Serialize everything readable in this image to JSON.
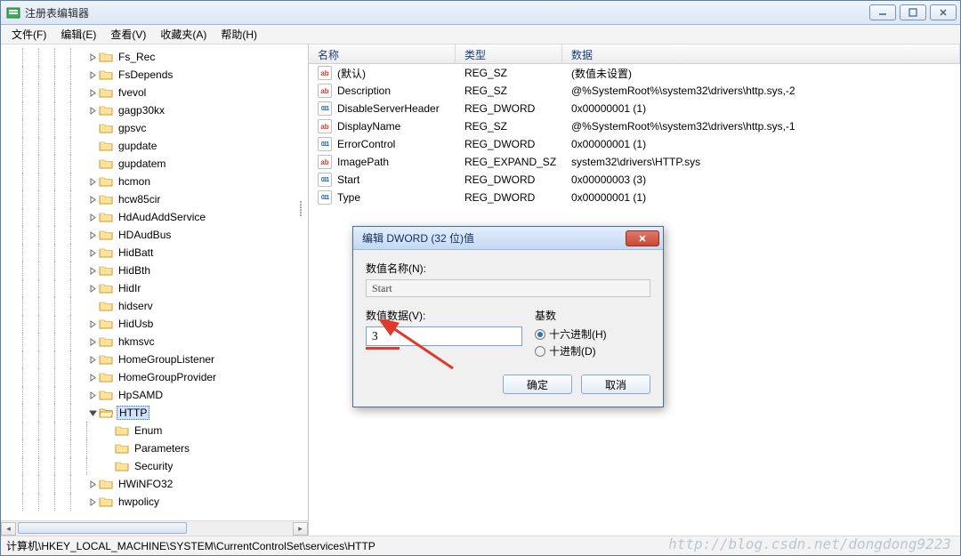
{
  "window": {
    "title": "注册表编辑器"
  },
  "menu": {
    "file": "文件(F)",
    "edit": "编辑(E)",
    "view": "查看(V)",
    "favorites": "收藏夹(A)",
    "help": "帮助(H)"
  },
  "tree": {
    "items": [
      {
        "indent": 5,
        "exp": "closed",
        "label": "Fs_Rec"
      },
      {
        "indent": 5,
        "exp": "closed",
        "label": "FsDepends"
      },
      {
        "indent": 5,
        "exp": "closed",
        "label": "fvevol"
      },
      {
        "indent": 5,
        "exp": "closed",
        "label": "gagp30kx"
      },
      {
        "indent": 5,
        "exp": "none",
        "label": "gpsvc"
      },
      {
        "indent": 5,
        "exp": "none",
        "label": "gupdate"
      },
      {
        "indent": 5,
        "exp": "none",
        "label": "gupdatem"
      },
      {
        "indent": 5,
        "exp": "closed",
        "label": "hcmon"
      },
      {
        "indent": 5,
        "exp": "closed",
        "label": "hcw85cir"
      },
      {
        "indent": 5,
        "exp": "closed",
        "label": "HdAudAddService"
      },
      {
        "indent": 5,
        "exp": "closed",
        "label": "HDAudBus"
      },
      {
        "indent": 5,
        "exp": "closed",
        "label": "HidBatt"
      },
      {
        "indent": 5,
        "exp": "closed",
        "label": "HidBth"
      },
      {
        "indent": 5,
        "exp": "closed",
        "label": "HidIr"
      },
      {
        "indent": 5,
        "exp": "none",
        "label": "hidserv"
      },
      {
        "indent": 5,
        "exp": "closed",
        "label": "HidUsb"
      },
      {
        "indent": 5,
        "exp": "closed",
        "label": "hkmsvc"
      },
      {
        "indent": 5,
        "exp": "closed",
        "label": "HomeGroupListener"
      },
      {
        "indent": 5,
        "exp": "closed",
        "label": "HomeGroupProvider"
      },
      {
        "indent": 5,
        "exp": "closed",
        "label": "HpSAMD"
      },
      {
        "indent": 5,
        "exp": "open",
        "label": "HTTP",
        "selected": true
      },
      {
        "indent": 6,
        "exp": "none",
        "label": "Enum"
      },
      {
        "indent": 6,
        "exp": "none",
        "label": "Parameters"
      },
      {
        "indent": 6,
        "exp": "none",
        "label": "Security"
      },
      {
        "indent": 5,
        "exp": "closed",
        "label": "HWiNFO32"
      },
      {
        "indent": 5,
        "exp": "closed",
        "label": "hwpolicy"
      }
    ]
  },
  "list": {
    "columns": {
      "name": "名称",
      "type": "类型",
      "data": "数据"
    },
    "rows": [
      {
        "icon": "str",
        "name": "(默认)",
        "type": "REG_SZ",
        "data": "(数值未设置)"
      },
      {
        "icon": "str",
        "name": "Description",
        "type": "REG_SZ",
        "data": "@%SystemRoot%\\system32\\drivers\\http.sys,-2"
      },
      {
        "icon": "bin",
        "name": "DisableServerHeader",
        "type": "REG_DWORD",
        "data": "0x00000001 (1)"
      },
      {
        "icon": "str",
        "name": "DisplayName",
        "type": "REG_SZ",
        "data": "@%SystemRoot%\\system32\\drivers\\http.sys,-1"
      },
      {
        "icon": "bin",
        "name": "ErrorControl",
        "type": "REG_DWORD",
        "data": "0x00000001 (1)"
      },
      {
        "icon": "str",
        "name": "ImagePath",
        "type": "REG_EXPAND_SZ",
        "data": "system32\\drivers\\HTTP.sys"
      },
      {
        "icon": "bin",
        "name": "Start",
        "type": "REG_DWORD",
        "data": "0x00000003 (3)"
      },
      {
        "icon": "bin",
        "name": "Type",
        "type": "REG_DWORD",
        "data": "0x00000001 (1)"
      }
    ]
  },
  "status": {
    "path": "计算机\\HKEY_LOCAL_MACHINE\\SYSTEM\\CurrentControlSet\\services\\HTTP"
  },
  "dialog": {
    "title": "编辑 DWORD (32 位)值",
    "name_label": "数值名称(N):",
    "name_value": "Start",
    "data_label": "数值数据(V):",
    "data_value": "3",
    "base_label": "基数",
    "radio_hex": "十六进制(H)",
    "radio_dec": "十进制(D)",
    "ok": "确定",
    "cancel": "取消"
  },
  "watermark": "http://blog.csdn.net/dongdong9223"
}
